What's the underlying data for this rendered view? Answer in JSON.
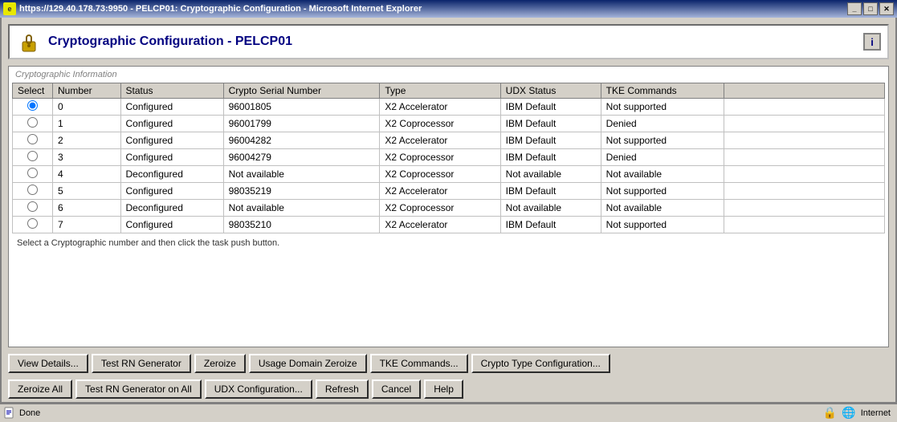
{
  "titlebar": {
    "url": "https://129.40.178.73:9950 - PELCP01: Cryptographic Configuration - Microsoft Internet Explorer",
    "controls": [
      "_",
      "□",
      "✕"
    ]
  },
  "window": {
    "title": "Cryptographic Configuration - PELCP01",
    "info_tooltip": "i"
  },
  "group_label": "Cryptographic Information",
  "table": {
    "headers": [
      "Select",
      "Number",
      "Status",
      "Crypto Serial Number",
      "Type",
      "UDX Status",
      "TKE Commands"
    ],
    "rows": [
      {
        "selected": true,
        "number": "0",
        "status": "Configured",
        "serial": "96001805",
        "type": "X2 Accelerator",
        "udx": "IBM Default",
        "tke": "Not supported"
      },
      {
        "selected": false,
        "number": "1",
        "status": "Configured",
        "serial": "96001799",
        "type": "X2 Coprocessor",
        "udx": "IBM Default",
        "tke": "Denied"
      },
      {
        "selected": false,
        "number": "2",
        "status": "Configured",
        "serial": "96004282",
        "type": "X2 Accelerator",
        "udx": "IBM Default",
        "tke": "Not supported"
      },
      {
        "selected": false,
        "number": "3",
        "status": "Configured",
        "serial": "96004279",
        "type": "X2 Coprocessor",
        "udx": "IBM Default",
        "tke": "Denied"
      },
      {
        "selected": false,
        "number": "4",
        "status": "Deconfigured",
        "serial": "Not available",
        "type": "X2 Coprocessor",
        "udx": "Not available",
        "tke": "Not available"
      },
      {
        "selected": false,
        "number": "5",
        "status": "Configured",
        "serial": "98035219",
        "type": "X2 Accelerator",
        "udx": "IBM Default",
        "tke": "Not supported"
      },
      {
        "selected": false,
        "number": "6",
        "status": "Deconfigured",
        "serial": "Not available",
        "type": "X2 Coprocessor",
        "udx": "Not available",
        "tke": "Not available"
      },
      {
        "selected": false,
        "number": "7",
        "status": "Configured",
        "serial": "98035210",
        "type": "X2 Accelerator",
        "udx": "IBM Default",
        "tke": "Not supported"
      }
    ]
  },
  "status_text": "Select a Cryptographic number and then click the task push button.",
  "action_buttons": [
    {
      "label": "View Details...",
      "name": "view-details-button"
    },
    {
      "label": "Test RN Generator",
      "name": "test-rn-generator-button"
    },
    {
      "label": "Zeroize",
      "name": "zeroize-button"
    },
    {
      "label": "Usage Domain Zeroize",
      "name": "usage-domain-zeroize-button"
    },
    {
      "label": "TKE Commands...",
      "name": "tke-commands-button"
    },
    {
      "label": "Crypto Type Configuration...",
      "name": "crypto-type-config-button"
    }
  ],
  "bottom_buttons": [
    {
      "label": "Zeroize All",
      "name": "zeroize-all-button"
    },
    {
      "label": "Test RN Generator on All",
      "name": "test-rn-all-button"
    },
    {
      "label": "UDX Configuration...",
      "name": "udx-config-button"
    },
    {
      "label": "Refresh",
      "name": "refresh-button"
    },
    {
      "label": "Cancel",
      "name": "cancel-button"
    },
    {
      "label": "Help",
      "name": "help-button"
    }
  ],
  "statusbar": {
    "text": "Done",
    "zone": "Internet"
  }
}
